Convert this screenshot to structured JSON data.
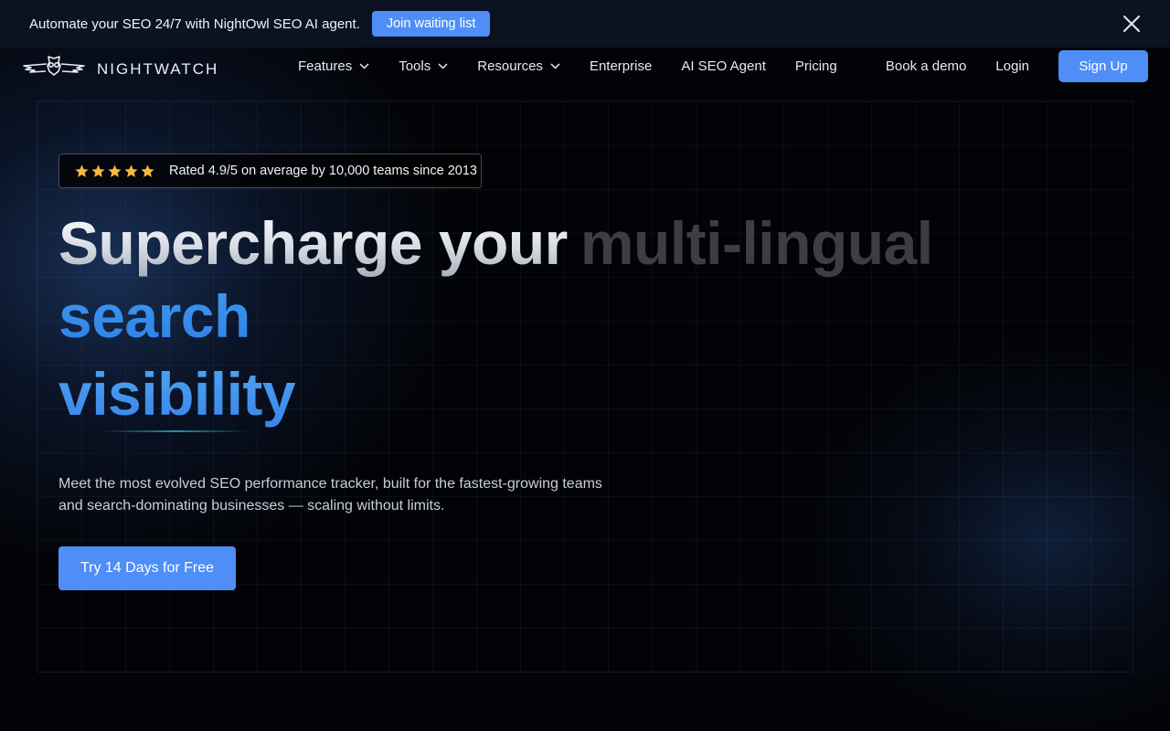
{
  "announcement": {
    "text": "Automate your SEO 24/7 with NightOwl SEO AI agent.",
    "button_label": "Join waiting list"
  },
  "nav": {
    "brand": "NIGHTWATCH",
    "links": [
      {
        "label": "Features",
        "has_dropdown": true
      },
      {
        "label": "Tools",
        "has_dropdown": true
      },
      {
        "label": "Resources",
        "has_dropdown": true
      },
      {
        "label": "Enterprise",
        "has_dropdown": false
      },
      {
        "label": "AI SEO Agent",
        "has_dropdown": false
      },
      {
        "label": "Pricing",
        "has_dropdown": false
      }
    ],
    "book_demo": "Book a demo",
    "login": "Login",
    "signup": "Sign Up"
  },
  "hero": {
    "rating_text": "Rated 4.9/5 on average by 10,000 teams since 2013",
    "stars": 5,
    "headline_part1": "Supercharge your",
    "headline_rotating": "multi-lingual",
    "headline_line2": "search",
    "headline_line3": "visibility",
    "subtext": "Meet the most evolved SEO performance tracker, built for the fastest-growing teams and search-dominating businesses — scaling without limits.",
    "cta_label": "Try 14 Days for Free"
  },
  "colors": {
    "accent": "#4f8ef7",
    "headline_blue": "#3b8ef0",
    "star": "#f5b942",
    "background": "#020306"
  },
  "icons": {
    "close": "close-icon",
    "chevron": "chevron-down-icon",
    "star": "star-icon",
    "logo": "owl-logo-icon"
  }
}
